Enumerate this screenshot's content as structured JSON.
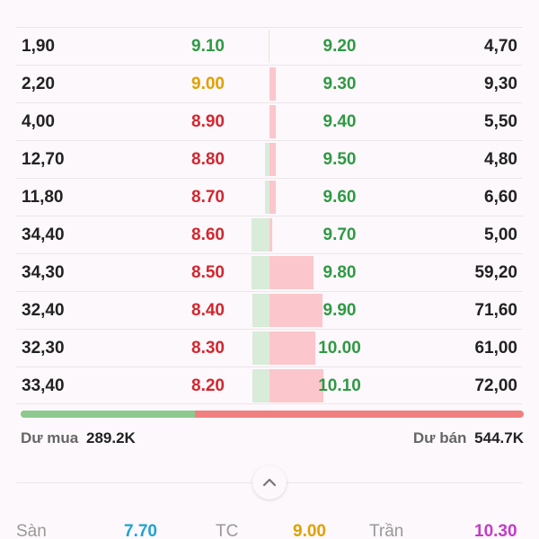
{
  "order_book": {
    "rows": [
      {
        "bid_volume": "1,90",
        "bid_price": "9.10",
        "bid_color": "green",
        "ask_price": "9.20",
        "ask_volume": "4,70",
        "bid_depth": 0.05,
        "ask_depth": 0.0
      },
      {
        "bid_volume": "2,20",
        "bid_price": "9.00",
        "bid_color": "yellow",
        "ask_price": "9.30",
        "ask_volume": "9,30",
        "bid_depth": 0.0,
        "ask_depth": 0.11
      },
      {
        "bid_volume": "4,00",
        "bid_price": "8.90",
        "bid_color": "red",
        "ask_price": "9.40",
        "ask_volume": "5,50",
        "bid_depth": 0.0,
        "ask_depth": 0.11
      },
      {
        "bid_volume": "12,70",
        "bid_price": "8.80",
        "bid_color": "red",
        "ask_price": "9.50",
        "ask_volume": "4,80",
        "bid_depth": 0.25,
        "ask_depth": 0.11
      },
      {
        "bid_volume": "11,80",
        "bid_price": "8.70",
        "bid_color": "red",
        "ask_price": "9.60",
        "ask_volume": "6,60",
        "bid_depth": 0.25,
        "ask_depth": 0.11
      },
      {
        "bid_volume": "34,40",
        "bid_price": "8.60",
        "bid_color": "red",
        "ask_price": "9.70",
        "ask_volume": "5,00",
        "bid_depth": 1.0,
        "ask_depth": 0.05
      },
      {
        "bid_volume": "34,30",
        "bid_price": "8.50",
        "bid_color": "red",
        "ask_price": "9.80",
        "ask_volume": "59,20",
        "bid_depth": 1.0,
        "ask_depth": 0.82
      },
      {
        "bid_volume": "32,40",
        "bid_price": "8.40",
        "bid_color": "red",
        "ask_price": "9.90",
        "ask_volume": "71,60",
        "bid_depth": 0.95,
        "ask_depth": 0.99
      },
      {
        "bid_volume": "32,30",
        "bid_price": "8.30",
        "bid_color": "red",
        "ask_price": "10.00",
        "ask_volume": "61,00",
        "bid_depth": 0.95,
        "ask_depth": 0.85
      },
      {
        "bid_volume": "33,40",
        "bid_price": "8.20",
        "bid_color": "red",
        "ask_price": "10.10",
        "ask_volume": "72,00",
        "bid_depth": 0.97,
        "ask_depth": 1.0
      }
    ]
  },
  "ratio": {
    "buy_fraction": 0.347
  },
  "totals": {
    "buy_label": "Dư mua",
    "buy_value": "289.2K",
    "sell_label": "Dư bán",
    "sell_value": "544.7K"
  },
  "collapse": {
    "icon": "chevron-up-icon"
  },
  "footer": {
    "floor_label": "Sàn",
    "floor_value": "7.70",
    "ref_label": "TC",
    "ref_value": "9.00",
    "ceiling_label": "Trần",
    "ceiling_value": "10.30"
  },
  "colors": {
    "green": "#2e9a44",
    "red": "#d3262f",
    "yellow": "#e0a000",
    "floor": "#1fa2d4",
    "ceiling": "#c23cc8",
    "ratio_buy": "#8ec98f",
    "ratio_sell": "#f08080"
  }
}
